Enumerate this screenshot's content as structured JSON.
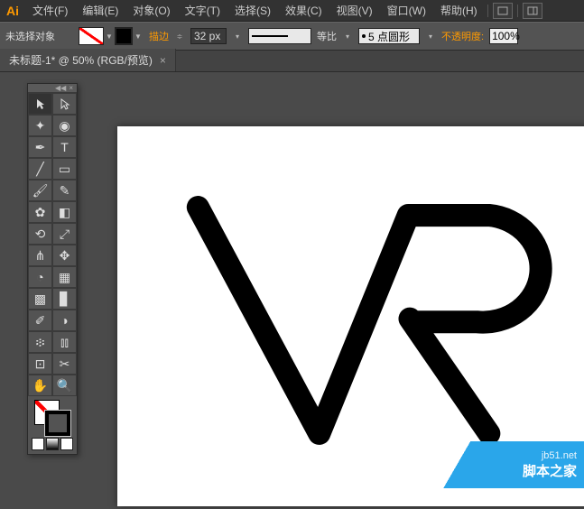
{
  "app": {
    "logo": "Ai"
  },
  "menu": {
    "items": [
      "文件(F)",
      "编辑(E)",
      "对象(O)",
      "文字(T)",
      "选择(S)",
      "效果(C)",
      "视图(V)",
      "窗口(W)",
      "帮助(H)"
    ]
  },
  "control": {
    "selection": "未选择对象",
    "stroke_label": "描边",
    "stroke_weight": "32 px",
    "scale_label": "等比",
    "profile": "5 点圆形",
    "opacity_label": "不透明度:",
    "opacity_value": "100%"
  },
  "doc": {
    "tab_title": "未标题-1* @ 50% (RGB/预览)",
    "close": "×"
  },
  "watermark": {
    "url": "jb51.net",
    "text": "脚本之家"
  }
}
